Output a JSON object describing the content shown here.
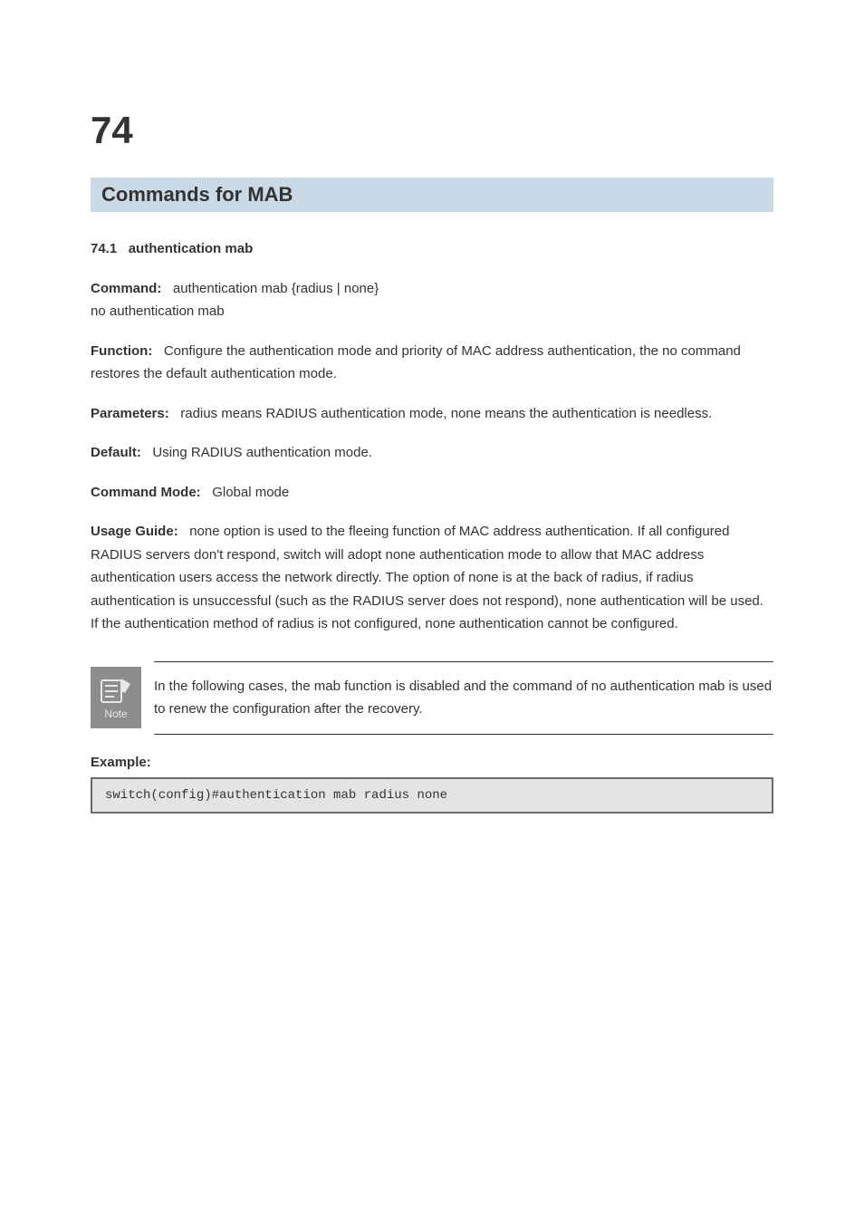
{
  "chapter": {
    "number": "74",
    "title": "Commands for MAB"
  },
  "section": {
    "number": "74.1",
    "name": "authentication mab"
  },
  "cmd": {
    "label_command": "Command:",
    "syntax_enable": "authentication mab {radius | none}",
    "syntax_disable": "no authentication mab",
    "label_function": "Function:",
    "function_text": "Configure the authentication mode and priority of MAC address authentication, the no command restores the default authentication mode.",
    "label_parameters": "Parameters:",
    "parameters_text": "radius means RADIUS authentication mode, none means the authentication is needless.",
    "label_default": "Default:",
    "default_text": "Using RADIUS authentication mode.",
    "label_mode": "Command Mode:",
    "mode_text": "Global mode",
    "label_usage": "Usage Guide:",
    "usage_text": "none option is used to the fleeing function of MAC address authentication. If all configured RADIUS servers don't respond, switch will adopt none authentication mode to allow that MAC address authentication users access the network directly. The option of none is at the back of radius, if radius authentication is unsuccessful (such as the RADIUS server does not respond), none authentication will be used. If the authentication method of radius is not configured, none authentication cannot be configured."
  },
  "note": {
    "icon_label": "Note",
    "text": "In the following cases, the mab function is disabled and the command of no authentication mab is used to renew the configuration after the recovery."
  },
  "example": {
    "label": "Example:",
    "code": "switch(config)#authentication mab radius none"
  }
}
